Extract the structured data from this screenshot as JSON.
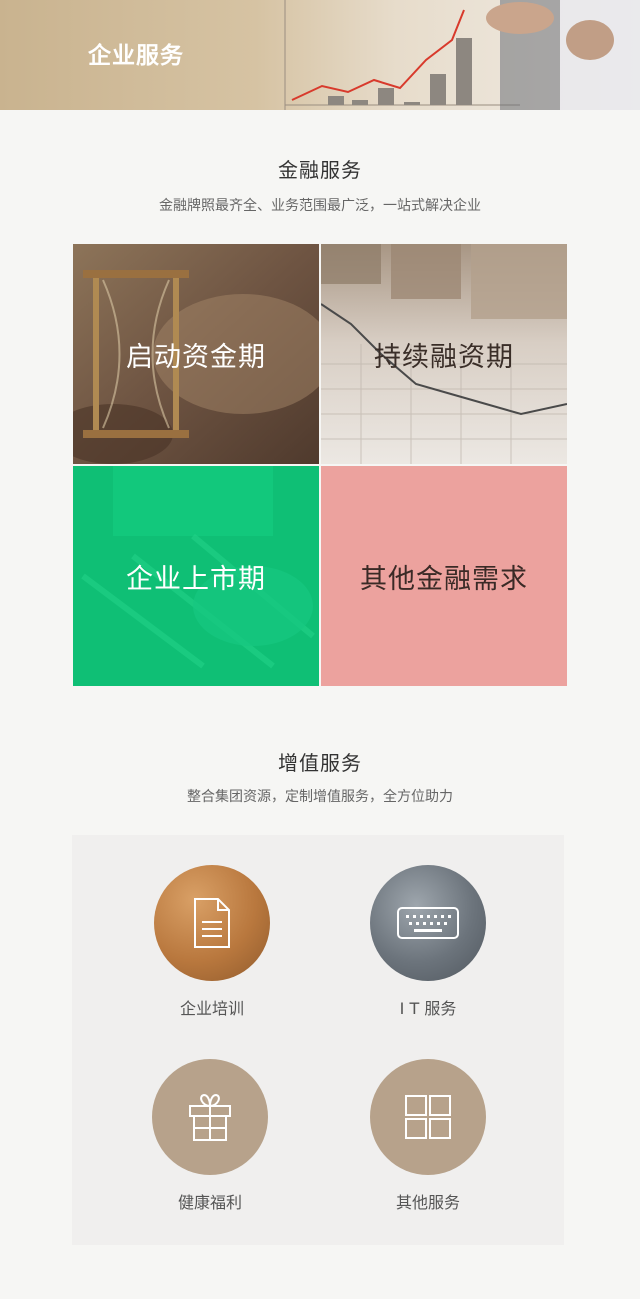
{
  "header": {
    "title": "企业服务"
  },
  "finance": {
    "title": "金融服务",
    "subtitle": "金融牌照最齐全、业务范围最广泛，一站式解决企业",
    "tiles": [
      {
        "label": "启动资金期"
      },
      {
        "label": "持续融资期"
      },
      {
        "label": "企业上市期"
      },
      {
        "label": "其他金融需求"
      }
    ]
  },
  "value_added": {
    "title": "增值服务",
    "subtitle": "整合集团资源，定制增值服务，全方位助力",
    "items": [
      {
        "label": "企业培训",
        "icon": "document-icon"
      },
      {
        "label": "I T 服务",
        "icon": "keyboard-icon"
      },
      {
        "label": "健康福利",
        "icon": "gift-icon"
      },
      {
        "label": "其他服务",
        "icon": "grid-icon"
      }
    ]
  },
  "colors": {
    "banner": "#d2bd9a",
    "tile_green": "#0fbf75",
    "tile_pink": "#eca29e",
    "circle_bronze": "#b9783e",
    "circle_steel": "#6c747c",
    "circle_taupe": "#b7a28b"
  }
}
